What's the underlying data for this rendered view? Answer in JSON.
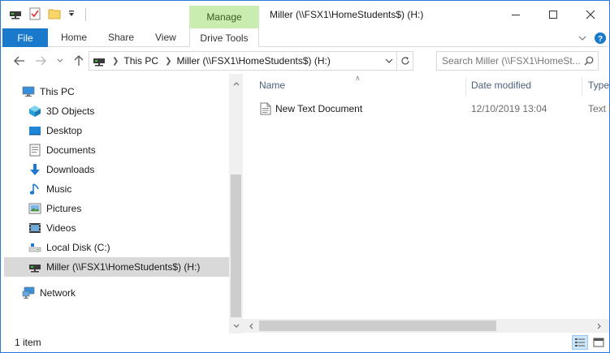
{
  "window": {
    "title": "Miller (\\\\FSX1\\HomeStudents$) (H:)",
    "contextual_tab": "Manage"
  },
  "ribbon": {
    "tabs": [
      "File",
      "Home",
      "Share",
      "View",
      "Drive Tools"
    ]
  },
  "address": {
    "crumbs": [
      "This PC",
      "Miller (\\\\FSX1\\HomeStudents$) (H:)"
    ]
  },
  "search": {
    "placeholder": "Search Miller (\\\\FSX1\\HomeSt..."
  },
  "nav": {
    "items": [
      {
        "label": "This PC",
        "icon": "computer-icon"
      },
      {
        "label": "3D Objects",
        "icon": "3d-objects-icon"
      },
      {
        "label": "Desktop",
        "icon": "desktop-icon"
      },
      {
        "label": "Documents",
        "icon": "documents-icon"
      },
      {
        "label": "Downloads",
        "icon": "downloads-icon"
      },
      {
        "label": "Music",
        "icon": "music-icon"
      },
      {
        "label": "Pictures",
        "icon": "pictures-icon"
      },
      {
        "label": "Videos",
        "icon": "videos-icon"
      },
      {
        "label": "Local Disk (C:)",
        "icon": "local-disk-icon"
      },
      {
        "label": "Miller (\\\\FSX1\\HomeStudents$) (H:)",
        "icon": "network-drive-icon",
        "selected": true
      },
      {
        "label": "Network",
        "icon": "network-icon"
      }
    ]
  },
  "columns": [
    "Name",
    "Date modified",
    "Type"
  ],
  "files": [
    {
      "name": "New Text Document",
      "date": "12/10/2019 13:04",
      "type": "Text D"
    }
  ],
  "status": {
    "item_count": "1 item"
  },
  "colors": {
    "file_tab": "#1979ca",
    "manage_tab": "#c9ecb0",
    "window_border": "#2b79d6",
    "selected_nav": "#d9d9d9"
  }
}
